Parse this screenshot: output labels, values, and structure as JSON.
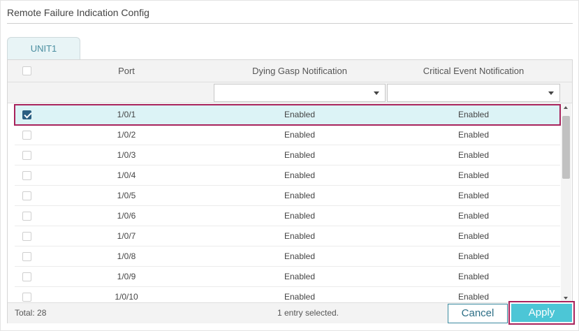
{
  "page": {
    "title": "Remote Failure Indication Config"
  },
  "tabs": [
    {
      "label": "UNIT1",
      "active": true
    }
  ],
  "table": {
    "columns": [
      "",
      "Port",
      "Dying Gasp Notification",
      "Critical Event Notification"
    ],
    "filters": {
      "dying_gasp": "",
      "critical_event": ""
    },
    "rows": [
      {
        "checked": true,
        "port": "1/0/1",
        "dying_gasp": "Enabled",
        "critical_event": "Enabled"
      },
      {
        "checked": false,
        "port": "1/0/2",
        "dying_gasp": "Enabled",
        "critical_event": "Enabled"
      },
      {
        "checked": false,
        "port": "1/0/3",
        "dying_gasp": "Enabled",
        "critical_event": "Enabled"
      },
      {
        "checked": false,
        "port": "1/0/4",
        "dying_gasp": "Enabled",
        "critical_event": "Enabled"
      },
      {
        "checked": false,
        "port": "1/0/5",
        "dying_gasp": "Enabled",
        "critical_event": "Enabled"
      },
      {
        "checked": false,
        "port": "1/0/6",
        "dying_gasp": "Enabled",
        "critical_event": "Enabled"
      },
      {
        "checked": false,
        "port": "1/0/7",
        "dying_gasp": "Enabled",
        "critical_event": "Enabled"
      },
      {
        "checked": false,
        "port": "1/0/8",
        "dying_gasp": "Enabled",
        "critical_event": "Enabled"
      },
      {
        "checked": false,
        "port": "1/0/9",
        "dying_gasp": "Enabled",
        "critical_event": "Enabled"
      },
      {
        "checked": false,
        "port": "1/0/10",
        "dying_gasp": "Enabled",
        "critical_event": "Enabled"
      }
    ]
  },
  "footer": {
    "total": "Total: 28",
    "selected": "1 entry selected."
  },
  "buttons": {
    "cancel": "Cancel",
    "apply": "Apply"
  },
  "colors": {
    "accent": "#4cc6d6",
    "selection_outline": "#a8235c",
    "selected_row": "#dcf3f6",
    "checkbox_checked": "#2b5f82"
  }
}
